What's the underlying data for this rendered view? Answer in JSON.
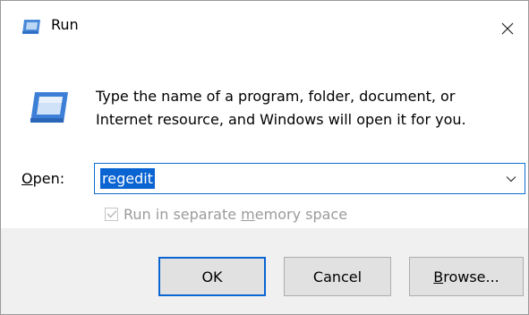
{
  "window": {
    "title": "Run",
    "title_icon": "run-icon",
    "close_glyph": "×"
  },
  "content": {
    "icon": "run-icon",
    "message_line1": "Type the name of a program, folder, document, or",
    "message_line2": "Internet resource, and Windows will open it for you."
  },
  "open": {
    "label_accel": "O",
    "label_rest": "pen:",
    "value": "regedit",
    "dropdown_icon": "chevron-down-icon"
  },
  "option": {
    "label_pre": "Run in separate ",
    "label_accel": "m",
    "label_post": "emory space",
    "checked": true,
    "enabled": false
  },
  "buttons": {
    "ok": "OK",
    "cancel": "Cancel",
    "browse_accel": "B",
    "browse_rest": "rowse..."
  },
  "colors": {
    "accent": "#0a64d2",
    "footer_bg": "#f0f0f0",
    "disabled_text": "#9b9b9b"
  }
}
